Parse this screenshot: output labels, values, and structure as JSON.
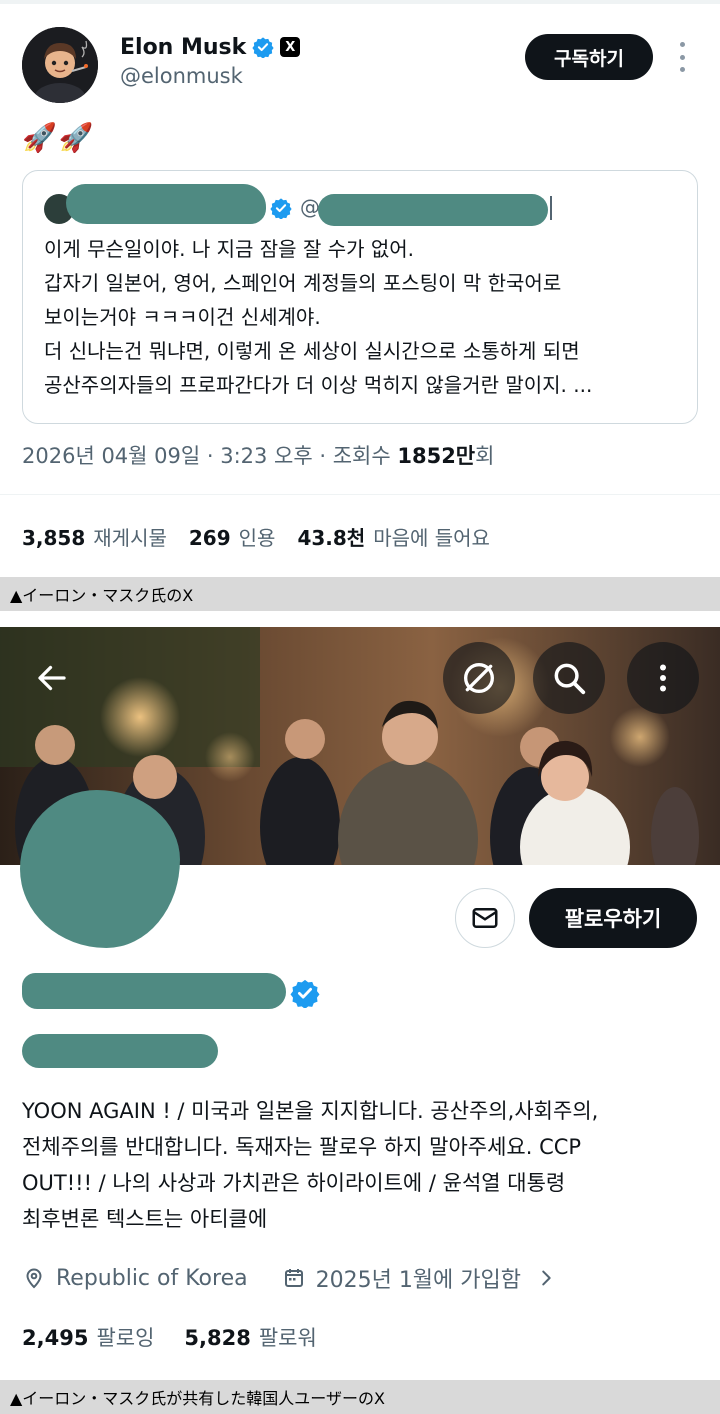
{
  "tweet": {
    "author_name": "Elon Musk",
    "author_handle": "@elonmusk",
    "x_badge": "X",
    "subscribe_label": "구독하기",
    "emoji_text": "🚀🚀",
    "quote": {
      "at_prefix": "@",
      "lines": [
        "이게 무슨일이야. 나 지금 잠을 잘 수가 없어.",
        "갑자기 일본어, 영어, 스페인어 계정들의 포스팅이 막 한국어로",
        "보이는거야 ㅋㅋㅋ이건 신세계야.",
        "더 신나는건 뭐냐면, 이렇게 온 세상이 실시간으로 소통하게 되면",
        "공산주의자들의 프로파간다가 더 이상 먹히지 않을거란 말이지. ..."
      ]
    },
    "meta_prefix": "2026년 04월 09일 · 3:23 오후 · 조회수 ",
    "views_value": "1852만",
    "views_suffix": "회",
    "stats": [
      {
        "value": "3,858",
        "label": "재게시물"
      },
      {
        "value": "269",
        "label": "인용"
      },
      {
        "value": "43.8천",
        "label": "마음에 들어요"
      }
    ]
  },
  "caption_1": "▲イーロン・マスク氏のX",
  "profile": {
    "message_icon": "mail-icon",
    "follow_label": "팔로우하기",
    "bio_lines": [
      "YOON AGAIN ! / 미국과 일본을 지지합니다. 공산주의,사회주의,",
      "전체주의를 반대합니다. 독재자는 팔로우 하지 말아주세요. CCP",
      "OUT!!! / 나의 사상과 가치관은 하이라이트에 / 윤석열 대통령",
      "최후변론 텍스트는 아티클에"
    ],
    "location": "Republic of Korea",
    "joined": "2025년 1월에 가입함",
    "following_value": "2,495",
    "following_label": "팔로잉",
    "followers_value": "5,828",
    "followers_label": "팔로워"
  },
  "caption_2": "▲イーロン・マスク氏が共有した韓国人ユーザーのX",
  "colors": {
    "text": "#0f1419",
    "secondary": "#536471",
    "verified_blue": "#1d9bf0",
    "redaction": "#4f8a82",
    "caption_bg": "#d9d9d9"
  }
}
